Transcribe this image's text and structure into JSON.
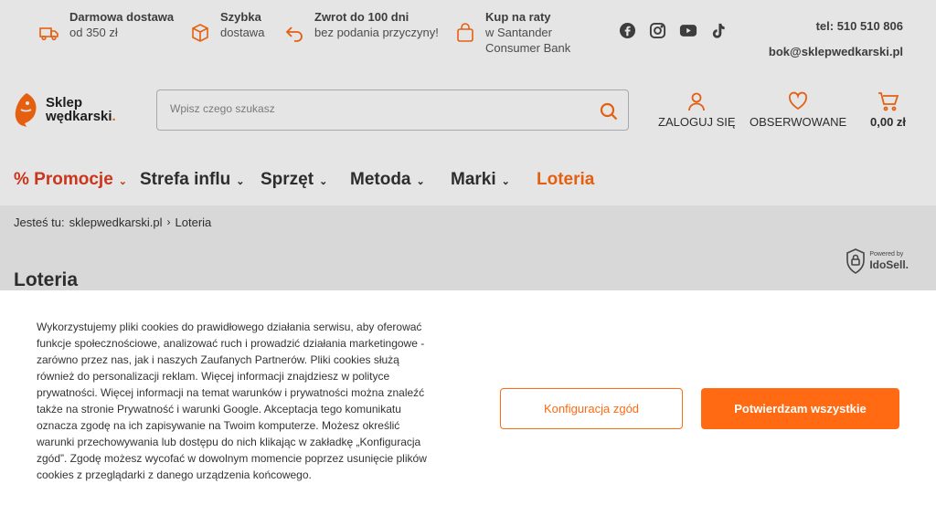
{
  "topbar": {
    "features": [
      {
        "title": "Darmowa dostawa",
        "sub": "od 350 zł",
        "icon": "truck-icon"
      },
      {
        "title": "Szybka",
        "sub": "dostawa",
        "icon": "package-icon"
      },
      {
        "title": "Zwrot do 100 dni",
        "sub": "bez podania przyczyny!",
        "icon": "return-arrow-icon"
      },
      {
        "title": "Kup na raty",
        "sub": "w Santander",
        "sub2": "Consumer Bank",
        "icon": "shopping-bag-icon"
      }
    ],
    "social": [
      "facebook-icon",
      "instagram-icon",
      "youtube-icon",
      "tiktok-icon"
    ],
    "phone": "tel: 510 510 806",
    "email": "bok@sklepwedkarski.pl"
  },
  "header": {
    "logo_line1": "Sklep",
    "logo_line2": "wędkarski",
    "logo_dot": ".",
    "search_placeholder": "Wpisz czego szukasz",
    "login": "ZALOGUJ SIĘ",
    "watch": "OBSERWOWANE",
    "cart_total": "0,00 zł"
  },
  "nav": {
    "items": [
      {
        "label": "% Promocje",
        "has_dropdown": true
      },
      {
        "label": "Strefa influ",
        "has_dropdown": true
      },
      {
        "label": "Sprzęt",
        "has_dropdown": true
      },
      {
        "label": "Metoda",
        "has_dropdown": true
      },
      {
        "label": "Marki",
        "has_dropdown": true
      },
      {
        "label": "Loteria",
        "has_dropdown": false
      }
    ]
  },
  "breadcrumb": {
    "prefix": "Jesteś tu:",
    "home": "sklepwedkarski.pl",
    "separator": "›",
    "current": "Loteria"
  },
  "page": {
    "title": "Loteria"
  },
  "badge": {
    "small": "Powered by",
    "big": "IdoSell."
  },
  "cookie": {
    "text": "Wykorzystujemy pliki cookies do prawidłowego działania serwisu, aby oferować funkcje społecznościowe, analizować ruch i prowadzić działania marketingowe - zarówno przez nas, jak i naszych Zaufanych Partnerów. Pliki cookies służą również do personalizacji reklam. Więcej informacji znajdziesz w polityce prywatności. Więcej informacji na temat warunków i prywatności można znaleźć także na stronie Prywatność i warunki Google. Akceptacja tego komunikatu oznacza zgodę na ich zapisywanie na Twoim komputerze. Możesz określić warunki przechowywania lub dostępu do nich klikając w zakładkę „Konfiguracja zgód”. Zgodę możesz wycofać w dowolnym momencie poprzez usunięcie plików cookies z przeglądarki z danego urządzenia końcowego.",
    "config_button": "Konfiguracja zgód",
    "accept_button": "Potwierdzam wszystkie"
  },
  "colors": {
    "accent": "#ff6a13",
    "promo": "#e23b1e",
    "text": "#333333",
    "muted_bg": "#f1f1f1"
  }
}
